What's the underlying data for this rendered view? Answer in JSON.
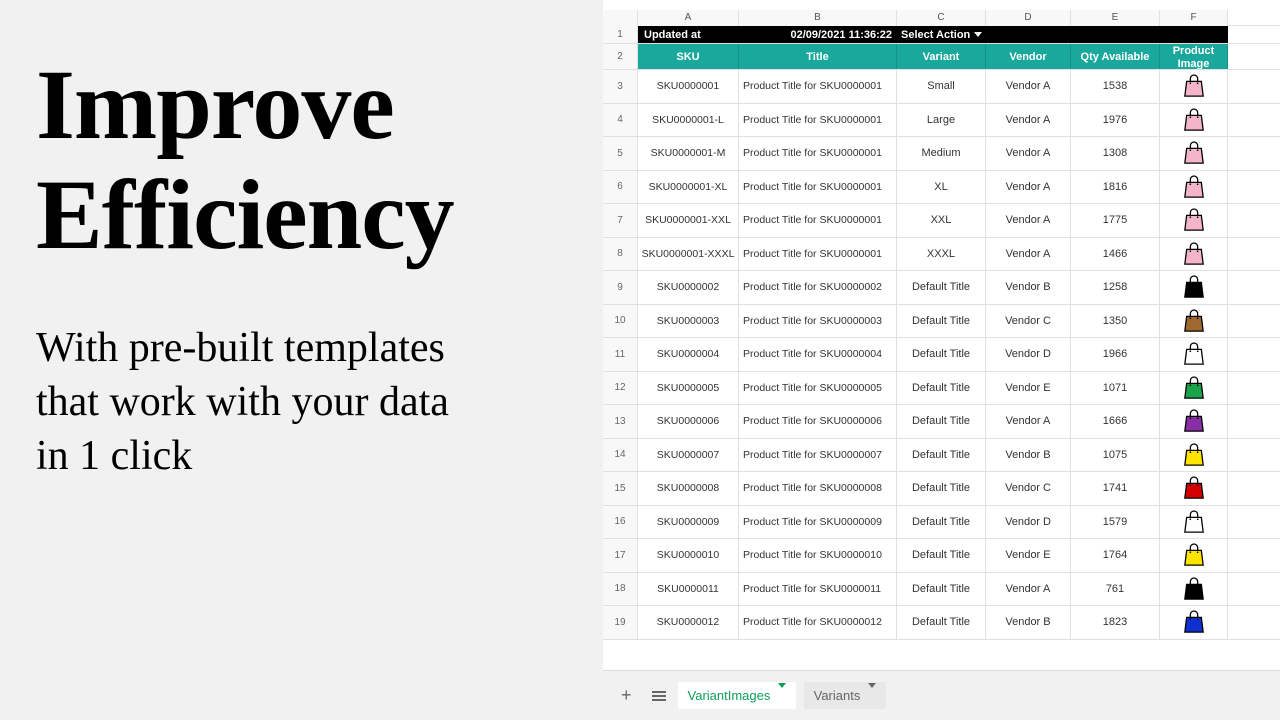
{
  "marketing": {
    "headline_line1": "Improve",
    "headline_line2": "Efficiency",
    "subhead": "With pre-built templates that work with your data in 1 click"
  },
  "sheet": {
    "col_letters": [
      "",
      "A",
      "B",
      "C",
      "D",
      "E",
      "F"
    ],
    "row1": {
      "num": "1",
      "updated_label": "Updated at",
      "timestamp": "02/09/2021 11:36:22",
      "action": "Select Action"
    },
    "row2": {
      "num": "2",
      "headers": [
        "SKU",
        "Title",
        "Variant",
        "Vendor",
        "Qty Available",
        "Product Image"
      ]
    },
    "rows": [
      {
        "num": "3",
        "sku": "SKU0000001",
        "title": "Product Title for SKU0000001",
        "variant": "Small",
        "vendor": "Vendor A",
        "qty": "1538",
        "bag": "#f4b5c9"
      },
      {
        "num": "4",
        "sku": "SKU0000001-L",
        "title": "Product Title for SKU0000001",
        "variant": "Large",
        "vendor": "Vendor A",
        "qty": "1976",
        "bag": "#f4b5c9"
      },
      {
        "num": "5",
        "sku": "SKU0000001-M",
        "title": "Product Title for SKU0000001",
        "variant": "Medium",
        "vendor": "Vendor A",
        "qty": "1308",
        "bag": "#f4b5c9"
      },
      {
        "num": "6",
        "sku": "SKU0000001-XL",
        "title": "Product Title for SKU0000001",
        "variant": "XL",
        "vendor": "Vendor A",
        "qty": "1816",
        "bag": "#f4b5c9"
      },
      {
        "num": "7",
        "sku": "SKU0000001-XXL",
        "title": "Product Title for SKU0000001",
        "variant": "XXL",
        "vendor": "Vendor A",
        "qty": "1775",
        "bag": "#f4b5c9"
      },
      {
        "num": "8",
        "sku": "SKU0000001-XXXL",
        "title": "Product Title for SKU0000001",
        "variant": "XXXL",
        "vendor": "Vendor A",
        "qty": "1466",
        "bag": "#f4b5c9"
      },
      {
        "num": "9",
        "sku": "SKU0000002",
        "title": "Product Title for SKU0000002",
        "variant": "Default Title",
        "vendor": "Vendor B",
        "qty": "1258",
        "bag": "#000000"
      },
      {
        "num": "10",
        "sku": "SKU0000003",
        "title": "Product Title for SKU0000003",
        "variant": "Default Title",
        "vendor": "Vendor C",
        "qty": "1350",
        "bag": "#a0672e"
      },
      {
        "num": "11",
        "sku": "SKU0000004",
        "title": "Product Title for SKU0000004",
        "variant": "Default Title",
        "vendor": "Vendor D",
        "qty": "1966",
        "bag": "#ffffff"
      },
      {
        "num": "12",
        "sku": "SKU0000005",
        "title": "Product Title for SKU0000005",
        "variant": "Default Title",
        "vendor": "Vendor E",
        "qty": "1071",
        "bag": "#1aa34a"
      },
      {
        "num": "13",
        "sku": "SKU0000006",
        "title": "Product Title for SKU0000006",
        "variant": "Default Title",
        "vendor": "Vendor A",
        "qty": "1666",
        "bag": "#8a2ea8"
      },
      {
        "num": "14",
        "sku": "SKU0000007",
        "title": "Product Title for SKU0000007",
        "variant": "Default Title",
        "vendor": "Vendor B",
        "qty": "1075",
        "bag": "#ffe400"
      },
      {
        "num": "15",
        "sku": "SKU0000008",
        "title": "Product Title for SKU0000008",
        "variant": "Default Title",
        "vendor": "Vendor C",
        "qty": "1741",
        "bag": "#d40000"
      },
      {
        "num": "16",
        "sku": "SKU0000009",
        "title": "Product Title for SKU0000009",
        "variant": "Default Title",
        "vendor": "Vendor D",
        "qty": "1579",
        "bag": "#ffffff"
      },
      {
        "num": "17",
        "sku": "SKU0000010",
        "title": "Product Title for SKU0000010",
        "variant": "Default Title",
        "vendor": "Vendor E",
        "qty": "1764",
        "bag": "#ffe400"
      },
      {
        "num": "18",
        "sku": "SKU0000011",
        "title": "Product Title for SKU0000011",
        "variant": "Default Title",
        "vendor": "Vendor A",
        "qty": "761",
        "bag": "#000000"
      },
      {
        "num": "19",
        "sku": "SKU0000012",
        "title": "Product Title for SKU0000012",
        "variant": "Default Title",
        "vendor": "Vendor B",
        "qty": "1823",
        "bag": "#1030d0"
      }
    ]
  },
  "tabs": {
    "active": "VariantImages",
    "inactive": "Variants"
  }
}
